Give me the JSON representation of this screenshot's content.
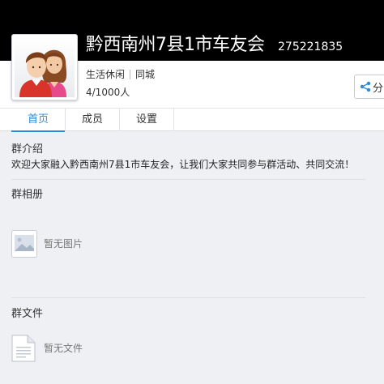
{
  "group": {
    "name": "黔西南州7县1市车友会",
    "id": "275221835",
    "category": "生活休闲",
    "scope": "同城",
    "members": "4/1000人",
    "share_label": "分"
  },
  "tabs": [
    {
      "label": "首页",
      "active": true
    },
    {
      "label": "成员",
      "active": false
    },
    {
      "label": "设置",
      "active": false
    }
  ],
  "intro": {
    "title": "群介绍",
    "text": "欢迎大家融入黔西南州7县1市车友会，让我们大家共同参与群活动、共同交流！"
  },
  "album": {
    "title": "群相册",
    "empty_text": "暂无图片"
  },
  "files": {
    "title": "群文件",
    "empty_text": "暂无文件"
  },
  "colors": {
    "header": "#000000",
    "accent": "#2e8ad8",
    "background": "#eef0f3"
  }
}
